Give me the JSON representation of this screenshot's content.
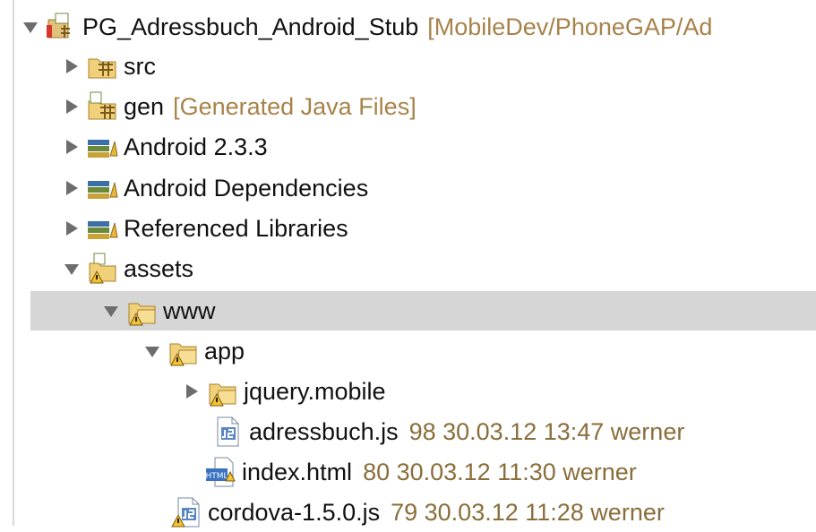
{
  "tree": {
    "root": {
      "label": "PG_Adressbuch_Android_Stub",
      "decoration": "[MobileDev/PhoneGAP/Ad"
    },
    "src": {
      "label": "src"
    },
    "gen": {
      "label": "gen",
      "decoration": "[Generated Java Files]"
    },
    "android_lib": {
      "label": "Android 2.3.3"
    },
    "android_deps": {
      "label": "Android Dependencies"
    },
    "referenced_libs": {
      "label": "Referenced Libraries"
    },
    "assets": {
      "label": "assets"
    },
    "www": {
      "label": "www"
    },
    "app": {
      "label": "app"
    },
    "jquery_mobile": {
      "label": "jquery.mobile"
    },
    "adressbuch_js": {
      "label": "adressbuch.js",
      "meta": "98  30.03.12 13:47  werner"
    },
    "index_html": {
      "label": "index.html",
      "meta": "80  30.03.12 11:30  werner"
    },
    "cordova_js": {
      "label": "cordova-1.5.0.js",
      "meta": "79  30.03.12 11:28  werner"
    }
  },
  "colors": {
    "selection": "#d6d6d6",
    "decoration": "#a7834a",
    "meta": "#8a6e3a"
  }
}
